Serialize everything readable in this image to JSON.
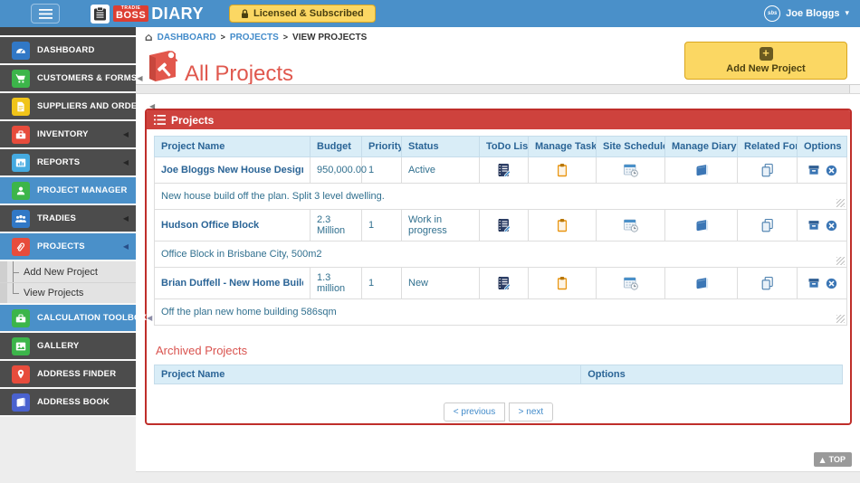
{
  "colors": {
    "topbar_blue": "#4a90c9",
    "sidebar_dark": "#4c4c4c",
    "active_blue": "#4a90c9",
    "panel_border_red": "#bf2e2a",
    "panel_header_red": "#ce423d",
    "table_header_bg": "#d9edf7",
    "table_header_text": "#2a6496",
    "license_yellow": "#fbd763",
    "title_orange": "#e0584e"
  },
  "icons": {
    "breadcrumb_home": "⌂",
    "sidebar_collapse_arrow": "◀",
    "user_caret": "▾",
    "top_arrow": "▲",
    "plus": "+",
    "crumb_sep": ">"
  },
  "topbar": {
    "brand_tiny": "TRADIE",
    "brand_boss": "BOSS",
    "brand_diary": "DIARY",
    "license_label": "Licensed & Subscribed",
    "user": {
      "avatar_text": "sbs",
      "name": "Joe Bloggs"
    }
  },
  "sidebar": {
    "items": [
      {
        "label": "DASHBOARD"
      },
      {
        "label": "CUSTOMERS & FORMS"
      },
      {
        "label": "SUPPLIERS AND ORDERS"
      },
      {
        "label": "INVENTORY"
      },
      {
        "label": "REPORTS"
      },
      {
        "label": "PROJECT MANAGER"
      },
      {
        "label": "TRADIES"
      },
      {
        "label": "PROJECTS"
      },
      {
        "label": "CALCULATION TOOLBOX"
      },
      {
        "label": "GALLERY"
      },
      {
        "label": "ADDRESS FINDER"
      },
      {
        "label": "ADDRESS BOOK"
      }
    ],
    "submenu": [
      {
        "label": "Add New Project"
      },
      {
        "label": "View Projects"
      }
    ]
  },
  "breadcrumb": {
    "item0": "DASHBOARD",
    "item1": "PROJECTS",
    "item2": "VIEW PROJECTS"
  },
  "header": {
    "title": "All Projects",
    "add_button_label": "Add New Project"
  },
  "panel": {
    "title": "Projects"
  },
  "table": {
    "headers": [
      "Project Name",
      "Budget",
      "Priority",
      "Status",
      "ToDo List",
      "Manage Tasks",
      "Site Schedule",
      "Manage Diary",
      "Related Forms",
      "Options"
    ],
    "rows": [
      {
        "name": "Joe Bloggs New House Design",
        "budget": "950,000.00",
        "priority": "1",
        "status": "Active",
        "description": "New house build off the plan. Split 3 level dwelling."
      },
      {
        "name": "Hudson Office Block",
        "budget": "2.3 Million",
        "priority": "1",
        "status": "Work in progress",
        "description": "Office Block in Brisbane City, 500m2"
      },
      {
        "name": "Brian Duffell - New Home Building",
        "budget": "1.3 million",
        "priority": "1",
        "status": "New",
        "description": "Off the plan new home building 586sqm"
      }
    ]
  },
  "archived": {
    "title": "Archived Projects",
    "headers": [
      "Project Name",
      "Options"
    ]
  },
  "pagination": {
    "prev": "< previous",
    "next": "> next"
  },
  "top_button": {
    "label": "TOP"
  }
}
